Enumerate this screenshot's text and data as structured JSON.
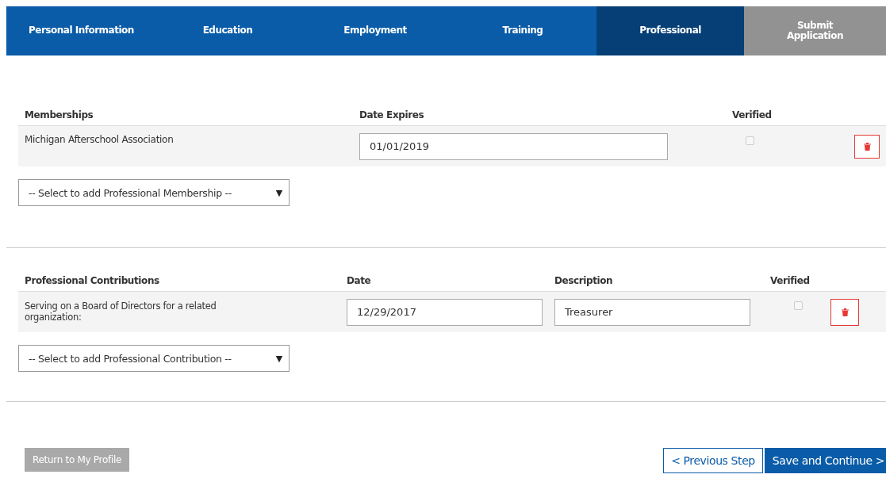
{
  "tabs": [
    {
      "label": "Personal Information",
      "selected": false,
      "disabled": false
    },
    {
      "label": "Education",
      "selected": false,
      "disabled": false
    },
    {
      "label": "Employment",
      "selected": false,
      "disabled": false
    },
    {
      "label": "Training",
      "selected": false,
      "disabled": false
    },
    {
      "label": "Professional",
      "selected": true,
      "disabled": false
    },
    {
      "label": "Submit Application",
      "selected": false,
      "disabled": true
    }
  ],
  "memberships": {
    "columns": [
      "Memberships",
      "Date Expires",
      "Verified"
    ],
    "rows": [
      {
        "name": "Michigan Afterschool Association",
        "date": "01/01/2019",
        "verified": false
      }
    ],
    "select": {
      "value": "-- Select to add Professional Membership --",
      "arrow": "▼"
    }
  },
  "contributions": {
    "columns": [
      "Professional Contributions",
      "Date",
      "Description",
      "Verified"
    ],
    "rows": [
      {
        "name": "Serving on a Board of Directors for a related organization:",
        "date": "12/29/2017",
        "description": "Treasurer",
        "verified": false
      }
    ],
    "select": {
      "value": "-- Select to add Professional Contribution --",
      "arrow": "▼"
    }
  },
  "footer": {
    "buttons": [
      {
        "label": "Return to My Profile",
        "kind": "secondary"
      },
      {
        "label": "< Previous Step",
        "kind": "outline"
      },
      {
        "label": "Save and Continue >",
        "kind": "primary"
      }
    ]
  }
}
